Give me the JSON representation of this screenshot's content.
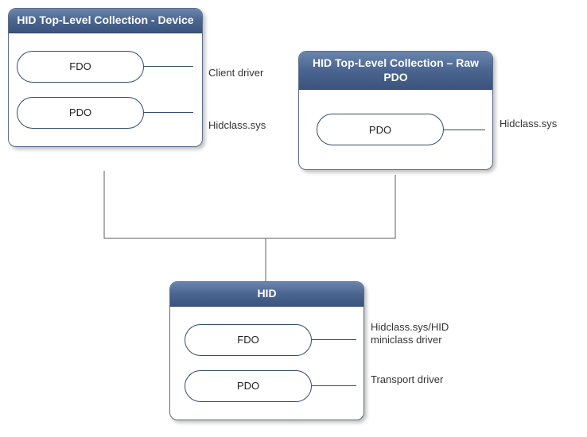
{
  "boxes": {
    "device": {
      "title": "HID Top-Level Collection - Device",
      "items": [
        {
          "label": "FDO",
          "side_label": "Client driver"
        },
        {
          "label": "PDO",
          "side_label": "Hidclass.sys"
        }
      ]
    },
    "rawpdo": {
      "title": "HID Top-Level Collection – Raw PDO",
      "items": [
        {
          "label": "PDO",
          "side_label": "Hidclass.sys"
        }
      ]
    },
    "hid": {
      "title": "HID",
      "items": [
        {
          "label": "FDO",
          "side_label": "Hidclass.sys/HID miniclass driver"
        },
        {
          "label": "PDO",
          "side_label": "Transport driver"
        }
      ]
    }
  }
}
